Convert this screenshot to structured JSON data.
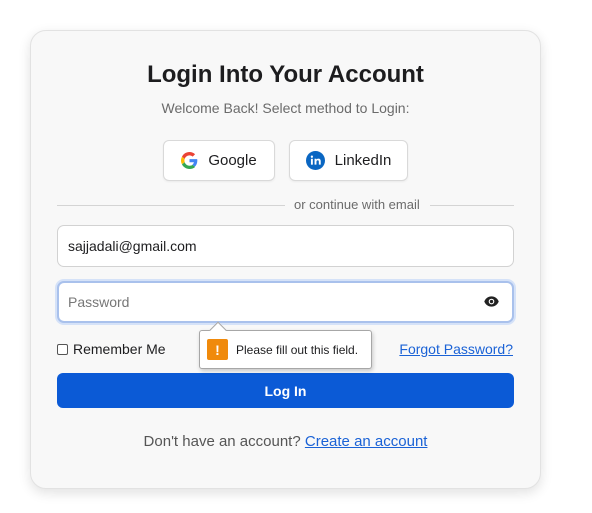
{
  "login": {
    "title": "Login Into Your Account",
    "subtitle": "Welcome Back! Select method to Login:",
    "google_label": "Google",
    "linkedin_label": "LinkedIn",
    "divider_text": "or continue with email",
    "email_value": "sajjadali@gmail.com",
    "password_placeholder": "Password",
    "remember_label": "Remember Me",
    "forgot_label": "Forgot Password?",
    "login_button": "Log In",
    "signup_prompt": "Don't have an account?",
    "signup_link": "Create an account"
  },
  "validation": {
    "message": "Please fill out this field.",
    "icon": "warning-icon"
  },
  "colors": {
    "primary": "#0b5ad6",
    "link": "#1a62d6",
    "warning": "#f08a0c",
    "linkedin": "#0a66c2"
  },
  "icons": {
    "google": "google-icon",
    "linkedin": "linkedin-icon",
    "eye": "eye-icon"
  }
}
